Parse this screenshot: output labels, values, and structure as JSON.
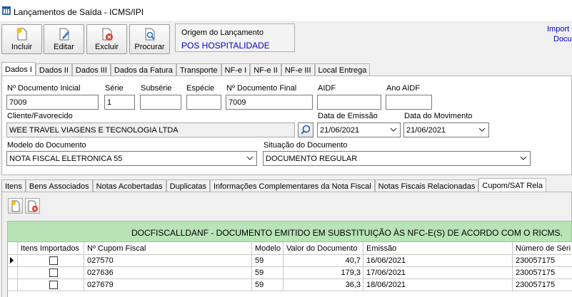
{
  "window": {
    "title": "Lançamentos de Saída - ICMS/IPI"
  },
  "toolbar": {
    "include_label": "Incluir",
    "edit_label": "Editar",
    "delete_label": "Excluir",
    "search_label": "Procurar"
  },
  "origem": {
    "label": "Origem do Lançamento",
    "value": "POS HOSPITALIDADE"
  },
  "import_link": {
    "line1": "Import",
    "line2": "Docu"
  },
  "tabs_top": [
    "Dados I",
    "Dados II",
    "Dados III",
    "Dados da Fatura",
    "Transporte",
    "NF-e I",
    "NF-e II",
    "NF-e III",
    "Local Entrega"
  ],
  "form": {
    "doc_inicial_label": "Nº Documento Inicial",
    "doc_inicial": "7009",
    "serie_label": "Série",
    "serie": "1",
    "subserie_label": "Subsérie",
    "subserie": "",
    "especie_label": "Espécie",
    "especie": "",
    "doc_final_label": "Nº Documento Final",
    "doc_final": "7009",
    "aidf_label": "AIDF",
    "aidf": "",
    "ano_aidf_label": "Ano AIDF",
    "ano_aidf": "",
    "cliente_label": "Cliente/Favorecido",
    "cliente": "WEE TRAVEL VIAGENS E TECNOLOGIA LTDA",
    "data_emissao_label": "Data de Emissão",
    "data_emissao": "21/06/2021",
    "data_mov_label": "Data do Movimento",
    "data_mov": "21/06/2021",
    "modelo_label": "Modelo do Documento",
    "modelo": "NOTA FISCAL ELETRONICA 55",
    "situacao_label": "Situação do Documento",
    "situacao": "DOCUMENTO REGULAR"
  },
  "tabs_bottom": [
    "Itens",
    "Bens Associados",
    "Notas Acobertadas",
    "Duplicatas",
    "Informações Complementares da Nota Fiscal",
    "Notas Fiscais Relacionadas",
    "Cupom/SAT Rela"
  ],
  "notice": "DOCFISCALLDANF  -  DOCUMENTO EMITIDO EM SUBSTITUIÇÃO ÀS NFC-E(S) DE ACORDO COM O RICMS.",
  "grid": {
    "headers": [
      "Itens Importados",
      "Nº Cupom Fiscal",
      "Modelo",
      "Valor do Documento",
      "Emissão",
      "Número de Séri"
    ],
    "rows": [
      {
        "imported": false,
        "cupom": "027570",
        "modelo": "59",
        "valor": "40,7",
        "emissao": "16/06/2021",
        "serie": "230057175"
      },
      {
        "imported": false,
        "cupom": "027636",
        "modelo": "59",
        "valor": "179,3",
        "emissao": "17/06/2021",
        "serie": "230057175"
      },
      {
        "imported": false,
        "cupom": "027679",
        "modelo": "59",
        "valor": "36,3",
        "emissao": "18/06/2021",
        "serie": "230057175"
      }
    ]
  },
  "colors": {
    "accent_blue": "#0000cc",
    "notice_green": "#b8e4b8"
  }
}
